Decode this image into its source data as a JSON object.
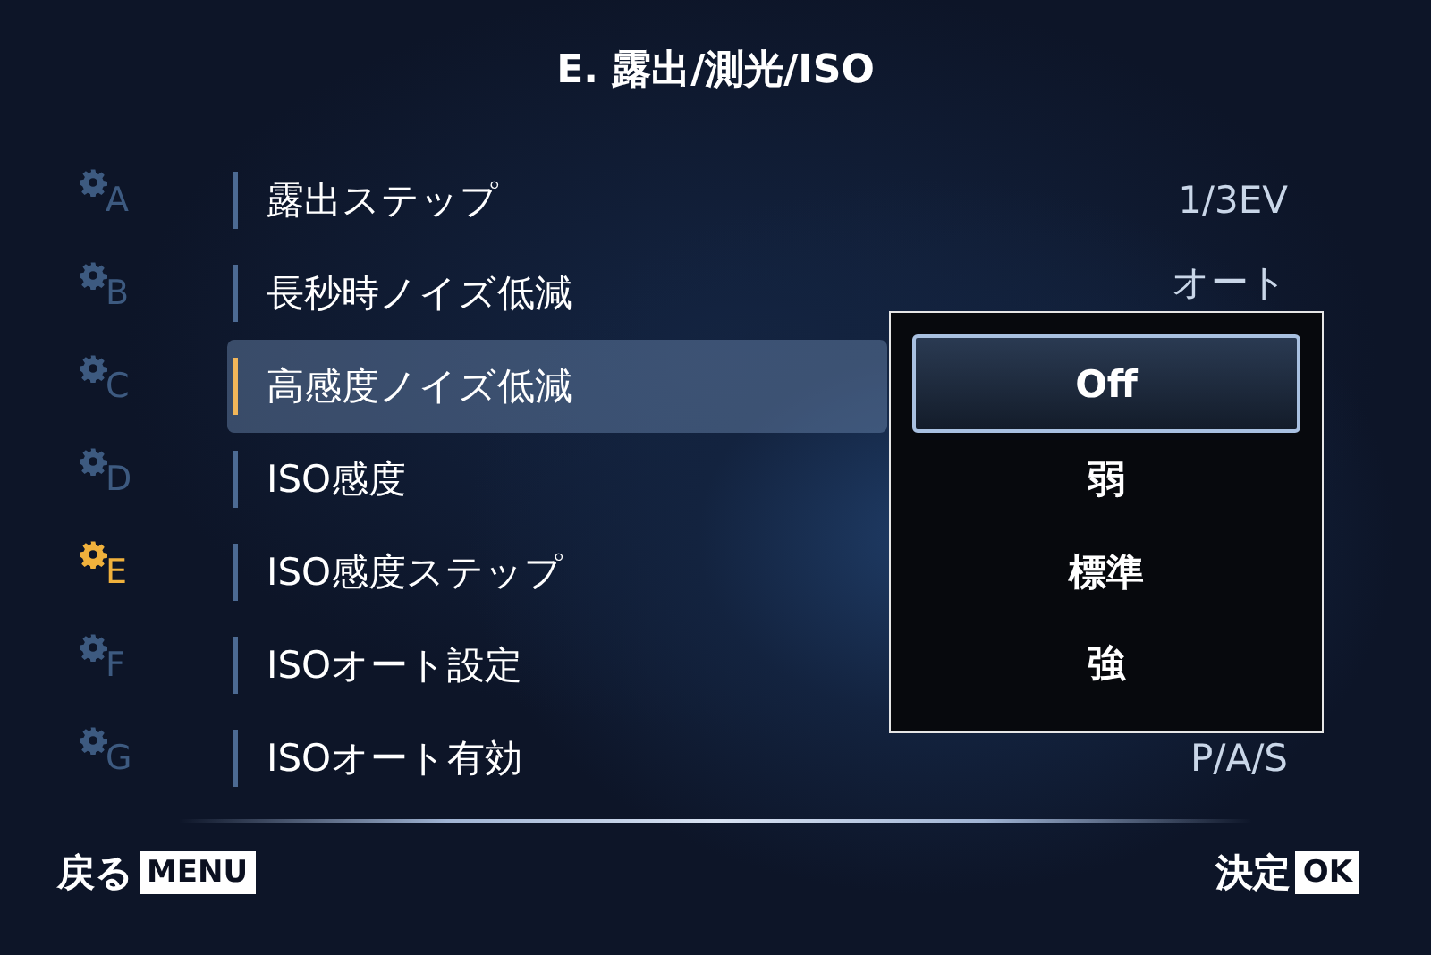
{
  "title": "E. 露出/測光/ISO",
  "tabs": [
    {
      "letter": "A",
      "selected": false
    },
    {
      "letter": "B",
      "selected": false
    },
    {
      "letter": "C",
      "selected": false
    },
    {
      "letter": "D",
      "selected": false
    },
    {
      "letter": "E",
      "selected": true
    },
    {
      "letter": "F",
      "selected": false
    },
    {
      "letter": "G",
      "selected": false
    }
  ],
  "items": [
    {
      "label": "露出ステップ",
      "value": "1/3EV",
      "selected": false
    },
    {
      "label": "長秒時ノイズ低減",
      "value": "オート",
      "selected": false
    },
    {
      "label": "高感度ノイズ低減",
      "selected": true
    },
    {
      "label": "ISO感度",
      "selected": false
    },
    {
      "label": "ISO感度ステップ",
      "selected": false
    },
    {
      "label": "ISOオート設定",
      "selected": false
    },
    {
      "label": "ISOオート有効",
      "value": "P/A/S",
      "selected": false
    }
  ],
  "popup": {
    "options": [
      {
        "label": "Off",
        "selected": true
      },
      {
        "label": "弱",
        "selected": false
      },
      {
        "label": "標準",
        "selected": false
      },
      {
        "label": "強",
        "selected": false
      }
    ]
  },
  "footer": {
    "back": {
      "label": "戻る",
      "key": "MENU"
    },
    "confirm": {
      "label": "決定",
      "key": "OK"
    }
  }
}
